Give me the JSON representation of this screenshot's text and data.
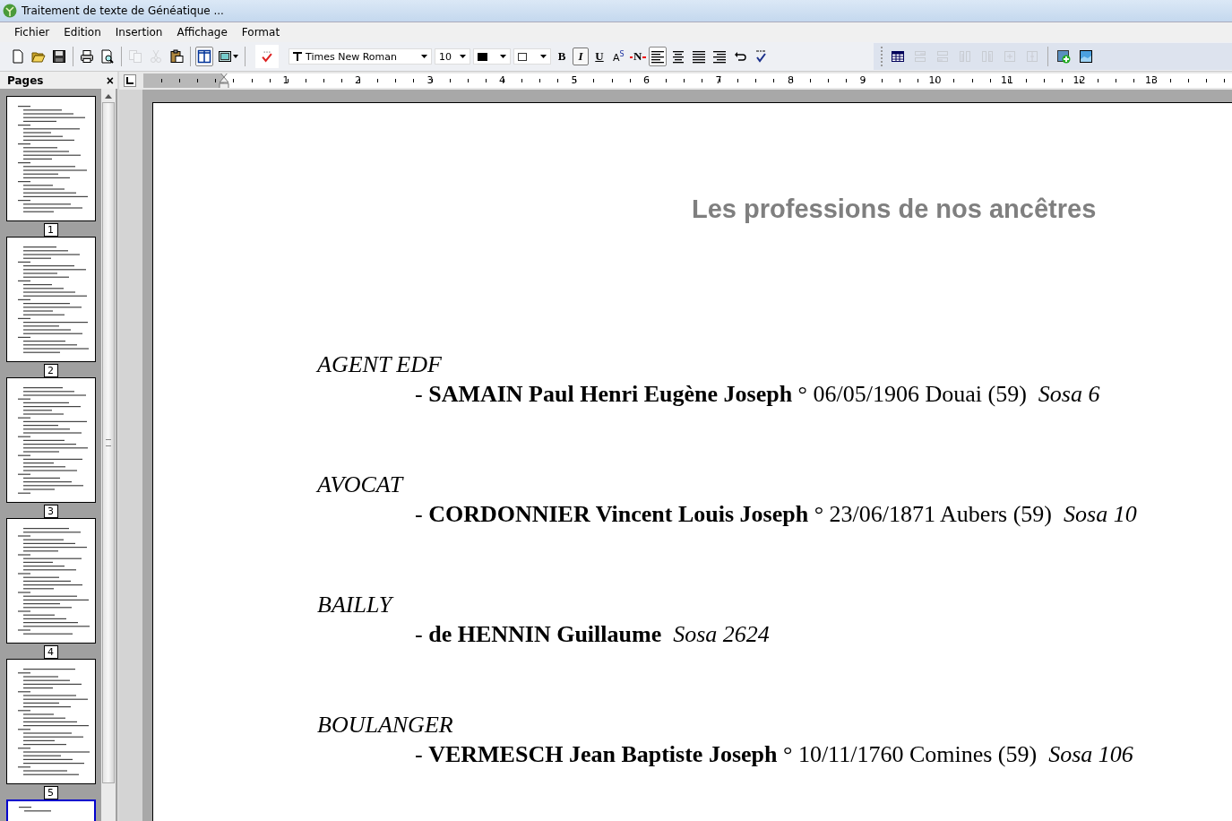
{
  "window": {
    "title": "Traitement de texte de Généatique ..."
  },
  "menu": [
    "Fichier",
    "Edition",
    "Insertion",
    "Affichage",
    "Format"
  ],
  "toolbar": {
    "file_tools": [
      [
        {
          "kind": "new",
          "disabled": false,
          "pressed": false
        },
        {
          "kind": "open",
          "disabled": false,
          "pressed": false
        },
        {
          "kind": "save",
          "disabled": false,
          "pressed": false
        }
      ],
      [
        {
          "kind": "print",
          "disabled": false,
          "pressed": false
        },
        {
          "kind": "preview",
          "disabled": false,
          "pressed": false
        }
      ],
      [
        {
          "kind": "copy",
          "disabled": true,
          "pressed": false
        },
        {
          "kind": "cut",
          "disabled": true,
          "pressed": false
        },
        {
          "kind": "paste",
          "disabled": false,
          "pressed": false
        }
      ],
      [
        {
          "kind": "layout",
          "disabled": false,
          "pressed": true
        },
        {
          "kind": "frame",
          "disabled": false,
          "pressed": false
        }
      ]
    ],
    "font": "Times New Roman",
    "size": "10",
    "format_buttons": [
      {
        "kind": "bold",
        "label": "B",
        "pressed": false
      },
      {
        "kind": "italic",
        "label": "I",
        "pressed": true
      },
      {
        "kind": "underline",
        "label": "U",
        "pressed": false
      },
      {
        "kind": "superscript",
        "label": "A$^{S}$",
        "pressed": false
      },
      {
        "kind": "strike",
        "label": "N",
        "pressed": false
      }
    ],
    "alignment": [
      {
        "kind": "left",
        "selected": true
      },
      {
        "kind": "center",
        "selected": false
      },
      {
        "kind": "justify",
        "selected": false
      },
      {
        "kind": "right",
        "selected": false
      }
    ],
    "table_tools": [
      [
        {
          "kind": "table",
          "disabled": false,
          "pressed": false
        },
        {
          "kind": "row-above",
          "disabled": true,
          "pressed": false
        },
        {
          "kind": "row-below",
          "disabled": true,
          "pressed": false
        },
        {
          "kind": "col-left",
          "disabled": true,
          "pressed": false
        },
        {
          "kind": "col-right",
          "disabled": true,
          "pressed": false
        },
        {
          "kind": "merge",
          "disabled": true,
          "pressed": false
        },
        {
          "kind": "split",
          "disabled": true,
          "pressed": false
        }
      ],
      [
        {
          "kind": "insert-image",
          "disabled": false,
          "pressed": false
        },
        {
          "kind": "picture",
          "disabled": false,
          "pressed": false
        }
      ]
    ]
  },
  "pages_panel": {
    "title": "Pages",
    "close": "×",
    "pages": [
      {
        "label": "1",
        "selected": false
      },
      {
        "label": "2",
        "selected": false
      },
      {
        "label": "3",
        "selected": false
      },
      {
        "label": "4",
        "selected": false
      },
      {
        "label": "5",
        "selected": false
      },
      {
        "selected": true
      }
    ]
  },
  "ruler": [
    "1",
    "2",
    "3",
    "4",
    "5",
    "6",
    "7",
    "8",
    "9",
    "10",
    "11",
    "12",
    "13"
  ],
  "document": {
    "title": "Les professions de nos ancêtres",
    "entries": [
      {
        "profession": "AGENT EDF",
        "detail": "- **SAMAIN Paul Henri Eugène Joseph** ° 06/05/1906 Douai (59)  *Sosa 6*"
      },
      {
        "profession": "AVOCAT",
        "detail": "- **CORDONNIER Vincent Louis Joseph** ° 23/06/1871 Aubers (59)  *Sosa 10*"
      },
      {
        "profession": "BAILLY",
        "detail": "- **de HENNIN Guillaume**  *Sosa 2624*"
      },
      {
        "profession": "BOULANGER",
        "detail": "- **VERMESCH Jean Baptiste Joseph** ° 10/11/1760 Comines (59)  *Sosa 106*"
      }
    ]
  }
}
